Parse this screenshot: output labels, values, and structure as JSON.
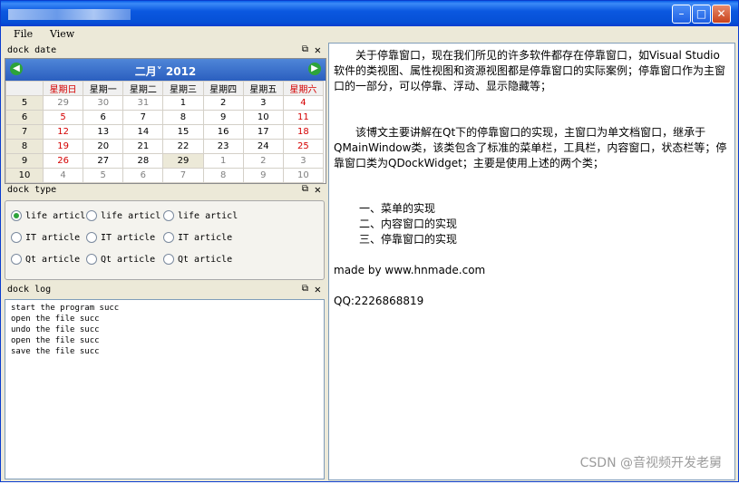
{
  "window": {
    "minimize_label": "–",
    "maximize_label": "□",
    "close_label": "✕"
  },
  "menu": {
    "file": "File",
    "view": "View"
  },
  "dock_date": {
    "title": "dock date",
    "float_glyph": "⧉",
    "close_glyph": "✕",
    "prev_glyph": "◀",
    "next_glyph": "▶",
    "month_year": "二月˅  2012",
    "weekdays": [
      "星期日",
      "星期一",
      "星期二",
      "星期三",
      "星期四",
      "星期五",
      "星期六"
    ],
    "weeks": [
      {
        "wk": "5",
        "days": [
          "29",
          "30",
          "31",
          "1",
          "2",
          "3",
          "4"
        ]
      },
      {
        "wk": "6",
        "days": [
          "5",
          "6",
          "7",
          "8",
          "9",
          "10",
          "11"
        ]
      },
      {
        "wk": "7",
        "days": [
          "12",
          "13",
          "14",
          "15",
          "16",
          "17",
          "18"
        ]
      },
      {
        "wk": "8",
        "days": [
          "19",
          "20",
          "21",
          "22",
          "23",
          "24",
          "25"
        ]
      },
      {
        "wk": "9",
        "days": [
          "26",
          "27",
          "28",
          "29",
          "1",
          "2",
          "3"
        ]
      },
      {
        "wk": "10",
        "days": [
          "4",
          "5",
          "6",
          "7",
          "8",
          "9",
          "10"
        ]
      }
    ]
  },
  "dock_type": {
    "title": "dock type",
    "float_glyph": "⧉",
    "close_glyph": "✕",
    "rows": [
      [
        "life articl",
        "life articl",
        "life articl"
      ],
      [
        "IT article",
        "IT article",
        "IT article"
      ],
      [
        "Qt article",
        "Qt article",
        "Qt article"
      ]
    ]
  },
  "dock_log": {
    "title": "dock log",
    "float_glyph": "⧉",
    "close_glyph": "✕",
    "lines": [
      "start the program succ",
      "open the file succ",
      "undo the file succ",
      "open the file succ",
      "save the file succ"
    ]
  },
  "content": {
    "p1": "　　关于停靠窗口，现在我们所见的许多软件都存在停靠窗口，如Visual Studio软件的类视图、属性视图和资源视图都是停靠窗口的实际案例；停靠窗口作为主窗口的一部分，可以停靠、浮动、显示隐藏等；",
    "p2": "　　该博文主要讲解在Qt下的停靠窗口的实现，主窗口为单文档窗口，继承于QMainWindow类，该类包含了标准的菜单栏，工具栏，内容窗口，状态栏等；停靠窗口类为QDockWidget；主要是使用上述的两个类；",
    "items": [
      "一、菜单的实现",
      "二、内容窗口的实现",
      "三、停靠窗口的实现"
    ],
    "made_by": "made by www.hnmade.com",
    "qq": "QQ:2226868819"
  },
  "watermark": "CSDN @音视频开发老舅"
}
